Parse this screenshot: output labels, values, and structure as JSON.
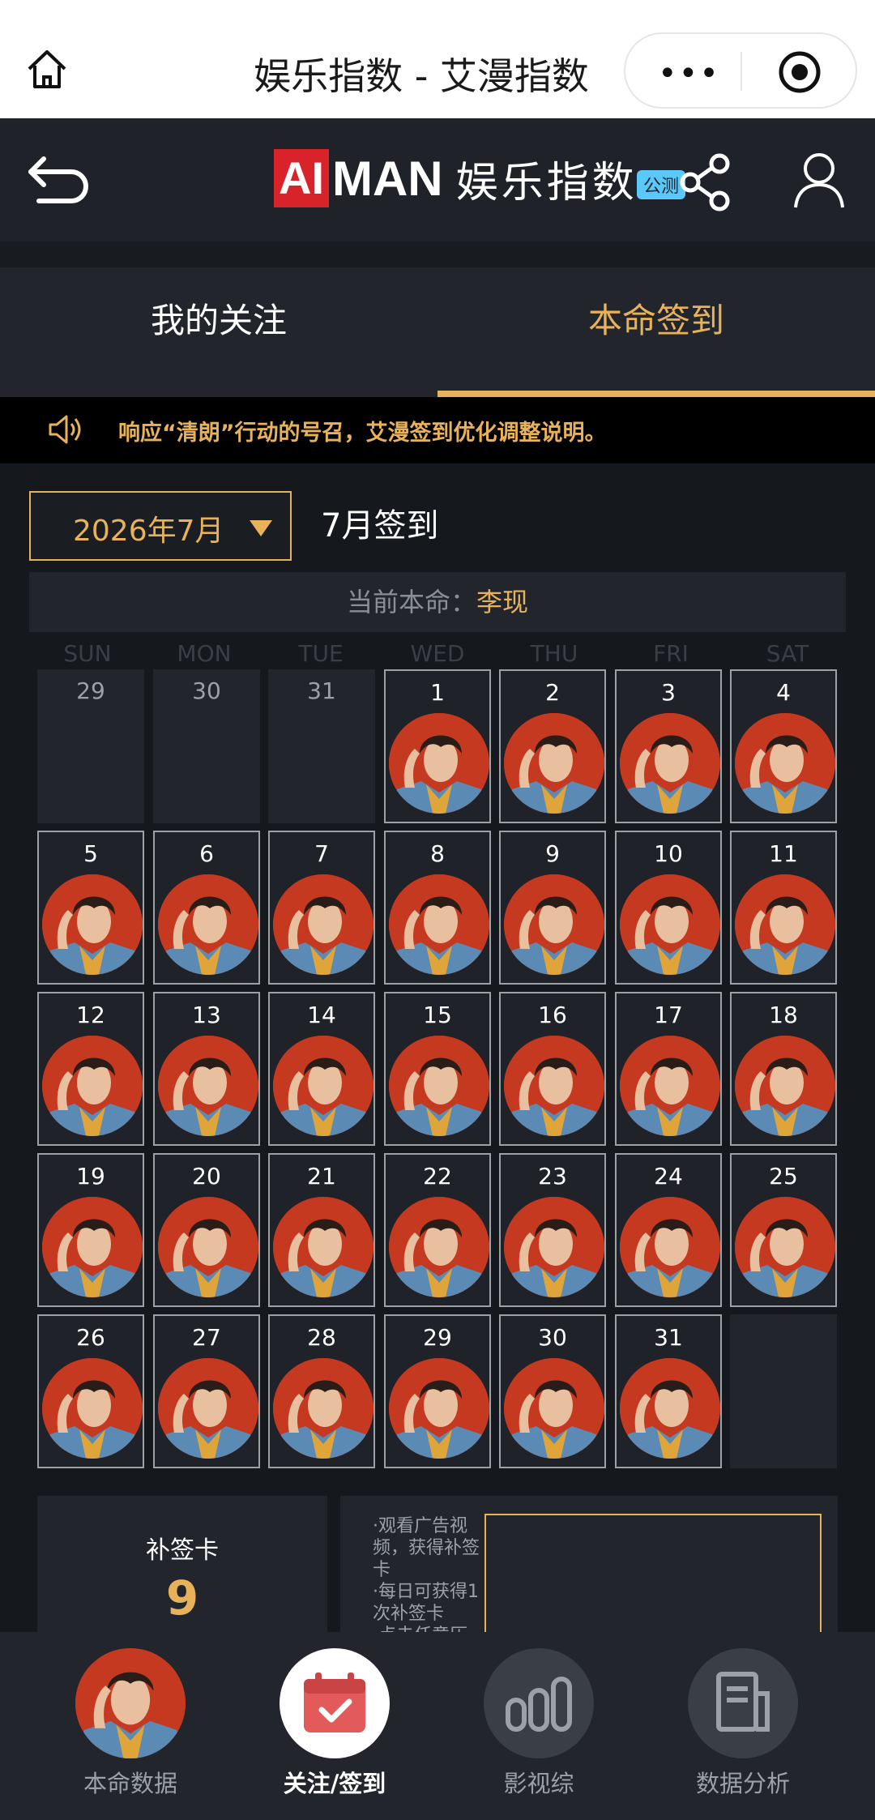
{
  "wx_bar": {
    "title": "娱乐指数 - 艾漫指数",
    "dots": "•••"
  },
  "header": {
    "logo_ai": "AI",
    "logo_man": "MAN",
    "logo_cn": "娱乐指数",
    "beta_badge": "公测"
  },
  "tabs": [
    {
      "label": "我的关注",
      "active": false
    },
    {
      "label": "本命签到",
      "active": true
    }
  ],
  "notice": {
    "text": "响应“清朗”行动的号召，艾漫签到优化调整说明。"
  },
  "calendar": {
    "month_selector": "2026年7月",
    "title": "7月签到",
    "current_label": "当前本命：",
    "current_name": "李现",
    "weekdays": [
      "SUN",
      "MON",
      "TUE",
      "WED",
      "THU",
      "FRI",
      "SAT"
    ],
    "leading_days": [
      "29",
      "30",
      "31"
    ],
    "days_in_month": 31,
    "signed_days": 31
  },
  "cards": {
    "makeup_card_label": "补签卡",
    "makeup_card_count": "9",
    "tips": "·观看广告视频，获得补签卡\n·每日可获得1次补签卡\n·点击任意历"
  },
  "tabbar": [
    {
      "label": "本命数据",
      "active": false,
      "icon": "avatar"
    },
    {
      "label": "关注/签到",
      "active": true,
      "icon": "calendar-check-icon"
    },
    {
      "label": "影视综",
      "active": false,
      "icon": "bar-chart-icon"
    },
    {
      "label": "数据分析",
      "active": false,
      "icon": "document-icon"
    }
  ],
  "colors": {
    "accent": "#e8b25a",
    "brand_red": "#d8232a",
    "background": "#15181d",
    "panel": "#22262c"
  }
}
